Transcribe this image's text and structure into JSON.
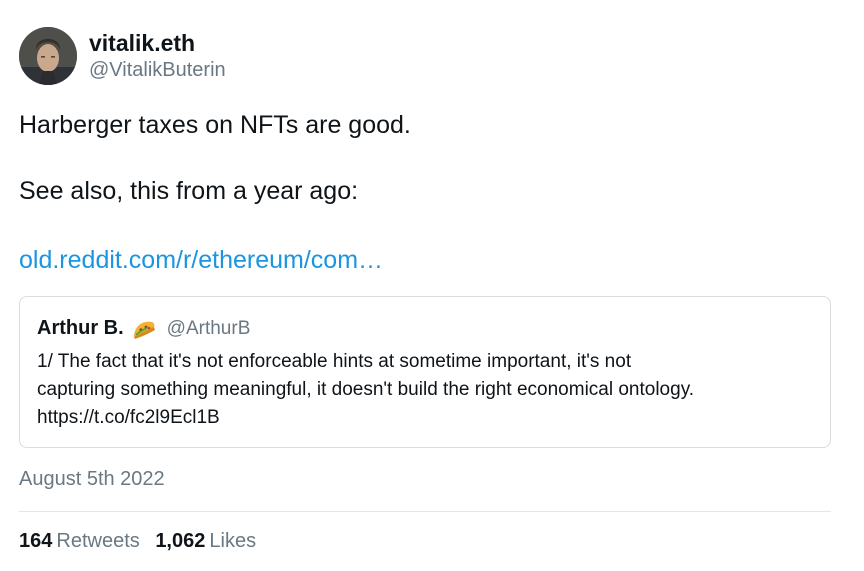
{
  "author": {
    "display_name": "vitalik.eth",
    "handle": "@VitalikButerin",
    "avatar_icon": "user-avatar"
  },
  "tweet": {
    "line1": "Harberger taxes on NFTs are good.",
    "line2": "See also, this from a year ago:",
    "link_text": "old.reddit.com/r/ethereum/com…"
  },
  "quote": {
    "display_name": "Arthur B.",
    "emoji_icon": "taco-icon",
    "handle": "@ArthurB",
    "text_lines": [
      "1/ The fact that it's not enforceable hints at sometime important, it's not",
      "capturing something meaningful, it doesn't build the right economical ontology.",
      "https://t.co/fc2l9Ecl1B"
    ]
  },
  "timestamp": "August 5th 2022",
  "stats": {
    "retweets_count": "164",
    "retweets_label": "Retweets",
    "likes_count": "1,062",
    "likes_label": "Likes"
  },
  "colors": {
    "link": "#1b95e0",
    "secondary_text": "#697882",
    "border": "#d8dde1"
  }
}
